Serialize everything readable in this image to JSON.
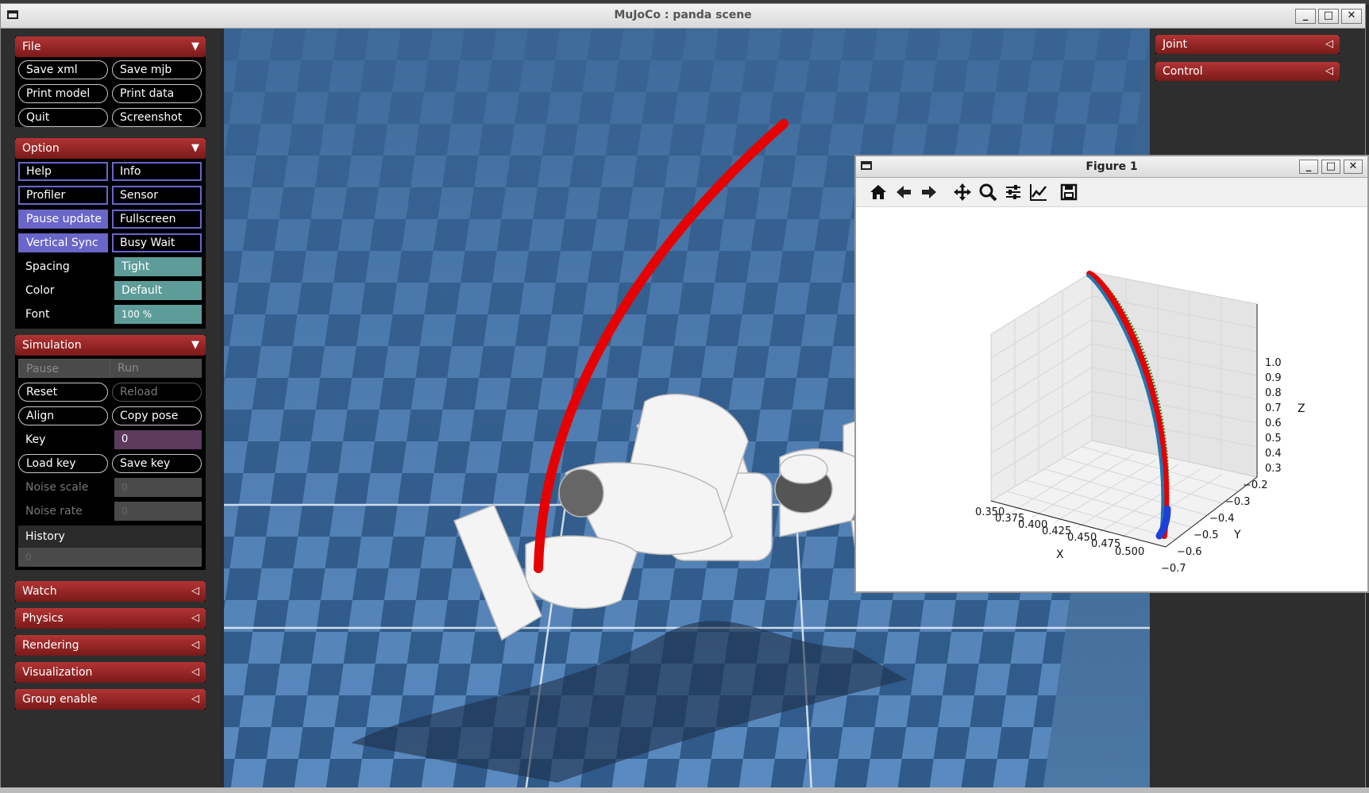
{
  "window": {
    "title": "MuJoCo : panda scene"
  },
  "left_panel": {
    "file": {
      "title": "File",
      "buttons": [
        "Save xml",
        "Save mjb",
        "Print model",
        "Print data",
        "Quit",
        "Screenshot"
      ]
    },
    "option": {
      "title": "Option",
      "checkboxes": [
        {
          "label": "Help",
          "on": false
        },
        {
          "label": "Info",
          "on": false
        },
        {
          "label": "Profiler",
          "on": false
        },
        {
          "label": "Sensor",
          "on": false
        },
        {
          "label": "Pause update",
          "on": true
        },
        {
          "label": "Fullscreen",
          "on": false
        },
        {
          "label": "Vertical Sync",
          "on": true
        },
        {
          "label": "Busy Wait",
          "on": false
        }
      ],
      "spacing_label": "Spacing",
      "spacing_value": "Tight",
      "color_label": "Color",
      "color_value": "Default",
      "font_label": "Font",
      "font_value": "100 %"
    },
    "simulation": {
      "title": "Simulation",
      "pause": "Pause",
      "run": "Run",
      "reset": "Reset",
      "reload": "Reload",
      "align": "Align",
      "copy_pose": "Copy pose",
      "key_label": "Key",
      "key_value": "0",
      "load_key": "Load key",
      "save_key": "Save key",
      "noise_scale_label": "Noise scale",
      "noise_scale_value": "0",
      "noise_rate_label": "Noise rate",
      "noise_rate_value": "0",
      "history_label": "History",
      "history_value": "0"
    },
    "collapsed": [
      "Watch",
      "Physics",
      "Rendering",
      "Visualization",
      "Group enable"
    ]
  },
  "right_panel": {
    "sections": [
      "Joint",
      "Control"
    ]
  },
  "figure": {
    "title": "Figure 1",
    "toolbar": [
      "home-icon",
      "back-arrow-icon",
      "forward-arrow-icon",
      "pan-icon",
      "zoom-icon",
      "configure-icon",
      "edit-axis-icon",
      "save-icon"
    ],
    "x_label": "X",
    "y_label": "Y",
    "z_label": "Z",
    "x_ticks": [
      "0.350",
      "0.375",
      "0.400",
      "0.425",
      "0.450",
      "0.475",
      "0.500"
    ],
    "y_ticks": [
      "−0.2",
      "−0.3",
      "−0.4",
      "−0.5",
      "−0.6",
      "−0.7"
    ],
    "z_ticks": [
      "1.0",
      "0.9",
      "0.8",
      "0.7",
      "0.6",
      "0.5",
      "0.4",
      "0.3"
    ]
  },
  "colors": {
    "accent_red": "#b23434",
    "checkbox_purple": "#6a66c9",
    "select_teal": "#5e9c99",
    "trajectory_red": "#e60000",
    "trajectory_blue": "#1f3fd6"
  }
}
